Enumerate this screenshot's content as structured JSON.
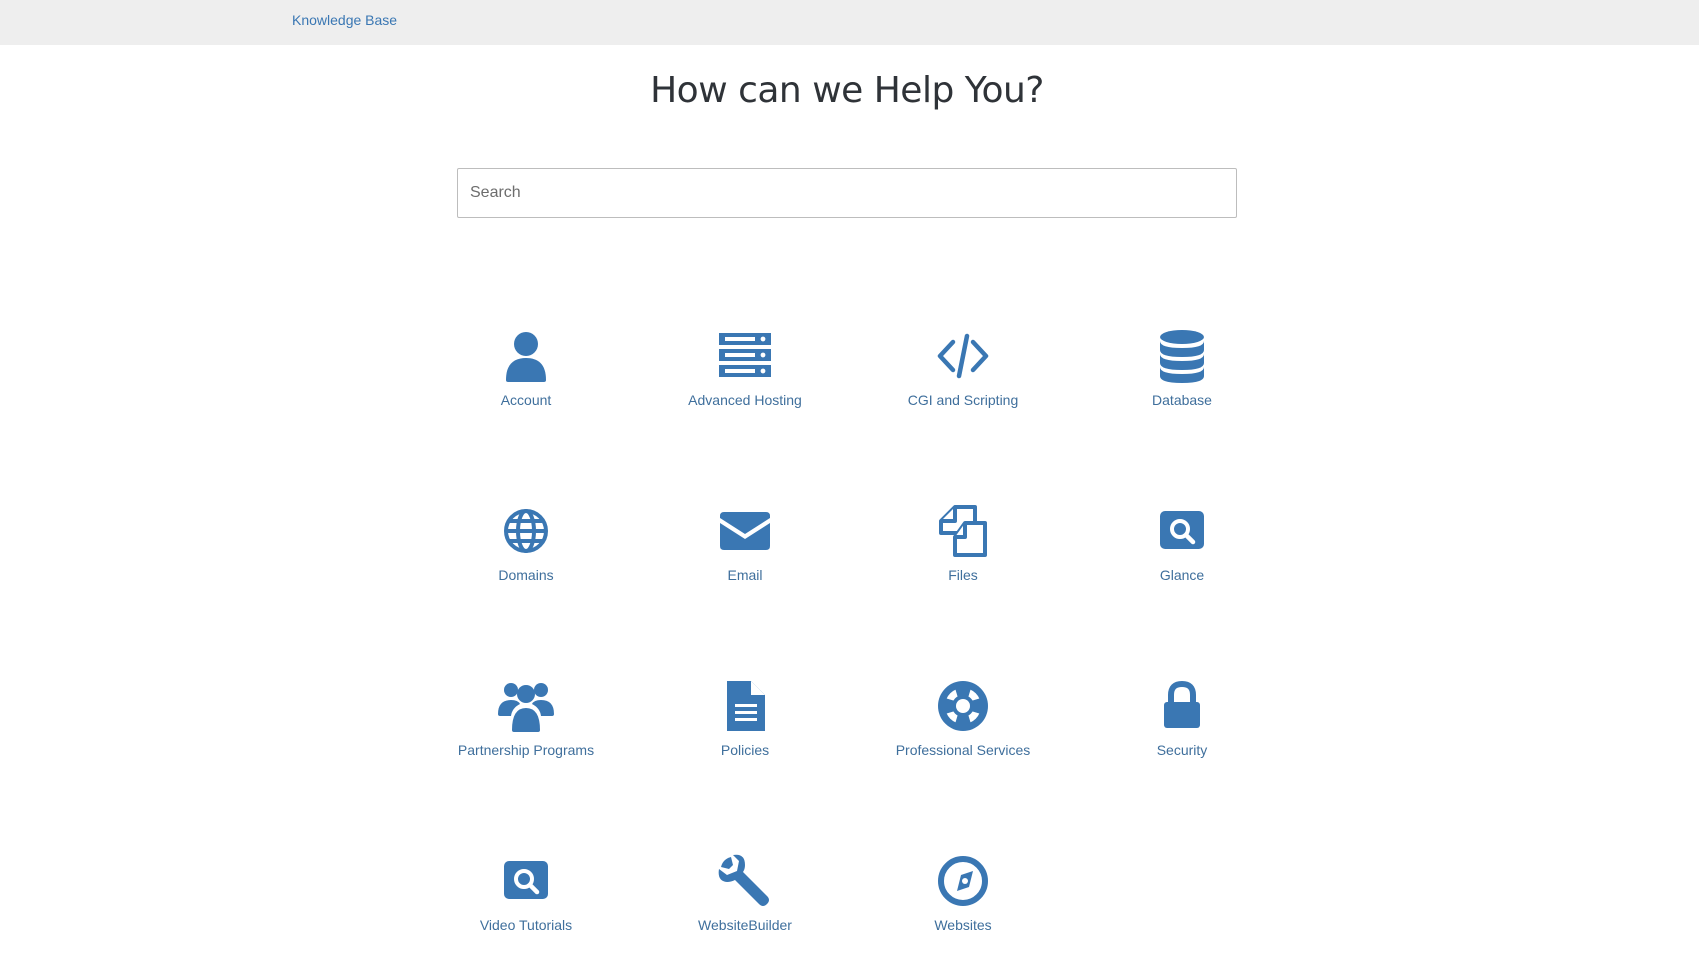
{
  "header": {
    "breadcrumb": "Knowledge Base"
  },
  "hero": {
    "title": "How can we Help You?"
  },
  "search": {
    "placeholder": "Search",
    "value": ""
  },
  "theme": {
    "accent": "#3a77b3",
    "topbar_bg": "#eeeeee",
    "title_color": "#2f3338"
  },
  "categories": [
    {
      "label": "Account",
      "icon": "user-icon"
    },
    {
      "label": "Advanced Hosting",
      "icon": "server-icon"
    },
    {
      "label": "CGI and Scripting",
      "icon": "code-icon"
    },
    {
      "label": "Database",
      "icon": "database-icon"
    },
    {
      "label": "Domains",
      "icon": "globe-icon"
    },
    {
      "label": "Email",
      "icon": "envelope-icon"
    },
    {
      "label": "Files",
      "icon": "files-icon"
    },
    {
      "label": "Glance",
      "icon": "search-square-icon"
    },
    {
      "label": "Partnership Programs",
      "icon": "users-icon"
    },
    {
      "label": "Policies",
      "icon": "document-icon"
    },
    {
      "label": "Professional Services",
      "icon": "life-ring-icon"
    },
    {
      "label": "Security",
      "icon": "lock-icon"
    },
    {
      "label": "Video Tutorials",
      "icon": "search-square-icon"
    },
    {
      "label": "WebsiteBuilder",
      "icon": "wrench-icon"
    },
    {
      "label": "Websites",
      "icon": "compass-icon"
    }
  ]
}
